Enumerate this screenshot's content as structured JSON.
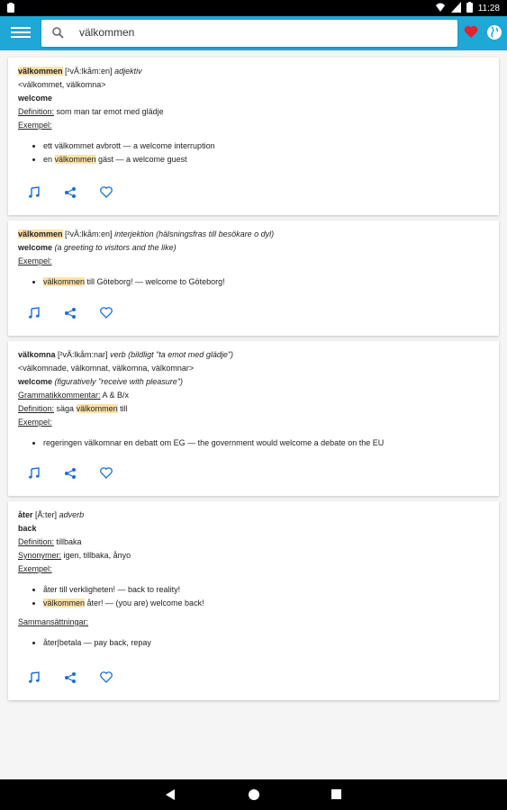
{
  "status": {
    "time": "11:28"
  },
  "search": {
    "value": "välkommen",
    "placeholder": ""
  },
  "entries": [
    {
      "word": "välkommen",
      "pron": "[²vÄ:lkåm:en]",
      "pos": "adjektiv",
      "forms": "<välkommet, välkomna>",
      "translation": "welcome",
      "definition_label": "Definition:",
      "definition": "som man tar emot med glädje",
      "exempel_label": "Exempel:",
      "examples": [
        {
          "pre": "ett välkommet avbrott — a welcome interruption",
          "hl": "",
          "post": ""
        },
        {
          "pre": "en ",
          "hl": "välkommen",
          "post": " gäst — a welcome guest"
        }
      ]
    },
    {
      "word": "välkommen",
      "pron": "[²vÄ:lkåm:en]",
      "pos": "interjektion (hälsningsfras till besökare o dyl)",
      "translation": "welcome",
      "translation_note": "(a greeting to visitors and the like)",
      "exempel_label": "Exempel:",
      "examples": [
        {
          "pre": "",
          "hl": "välkommen",
          "post": " till Göteborg! — welcome to Göteborg!"
        }
      ]
    },
    {
      "word": "välkomna",
      "pron": "[²vÄ:lkåm:nar]",
      "pos": "verb (bildligt \"ta emot med glädje\")",
      "forms": "<välkomnade, välkomnat, välkomna, välkomnar>",
      "translation": "welcome",
      "translation_note": "(figuratively \"receive with pleasure\")",
      "gram_label": "Grammatikkommentar:",
      "gram": "A & B/x",
      "definition_label": "Definition:",
      "def_pre": "säga ",
      "def_hl": "välkommen",
      "def_post": " till",
      "exempel_label": "Exempel:",
      "examples": [
        {
          "pre": "regeringen välkomnar en debatt om EG — the government would welcome a debate on the EU",
          "hl": "",
          "post": ""
        }
      ]
    },
    {
      "word": "åter",
      "pron": "[Å:ter]",
      "pos": "adverb",
      "translation": "back",
      "definition_label": "Definition:",
      "definition": "tillbaka",
      "synonymer_label": "Synonymer:",
      "synonymer": "igen, tillbaka, ånyo",
      "exempel_label": "Exempel:",
      "examples": [
        {
          "pre": "åter till verkligheten! — back to reality!",
          "hl": "",
          "post": ""
        },
        {
          "pre": "",
          "hl": "välkommen",
          "post": " åter! — (you are) welcome back!"
        }
      ],
      "samman_label": "Sammansättningar:",
      "samman": [
        "åter|betala — pay back, repay"
      ]
    }
  ],
  "icons": {
    "play": "music-note-icon",
    "share": "share-icon",
    "favorite": "heart-outline-icon"
  },
  "colors": {
    "appbar": "#1fa7d6",
    "highlight": "#ffe2a8",
    "action": "#1a6fd1",
    "heart": "#e8202f"
  }
}
